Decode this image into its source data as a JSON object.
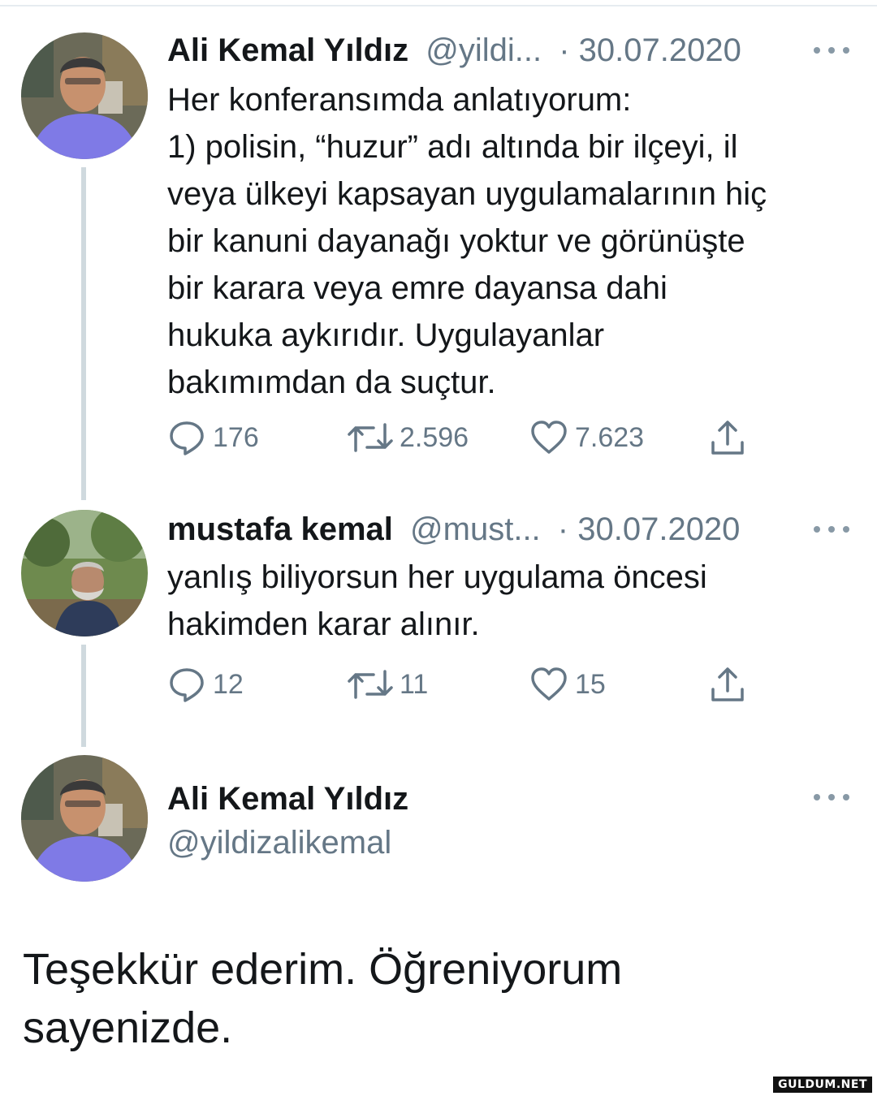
{
  "tweet1": {
    "name": "Ali Kemal Yıldız",
    "handle": "@yildi...",
    "date": "· 30.07.2020",
    "text": "Her konferansımda anlatıyorum:\n1) polisin, “huzur” adı altında bir ilçeyi, il\nveya ülkeyi kapsayan uygulamalarının hiç\nbir kanuni dayanağı yoktur ve görünüşte\nbir karara veya emre dayansa dahi\nhukuka aykırıdır. Uygulayanlar\nbakımımdan da suçtur.",
    "replies": "176",
    "retweets": "2.596",
    "likes": "7.623"
  },
  "tweet2": {
    "name": "mustafa kemal",
    "handle": "@must...",
    "date": "· 30.07.2020",
    "text": "yanlış biliyorsun her uygulama öncesi\nhakimden karar alınır.",
    "replies": "12",
    "retweets": "11",
    "likes": "15"
  },
  "tweet3": {
    "name": "Ali Kemal Yıldız",
    "handle": "@yildizalikemal",
    "text": "Teşekkür ederim. Öğreniyorum\nsayenizde."
  },
  "icons": {
    "reply": "reply-icon",
    "retweet": "retweet-icon",
    "like": "heart-icon",
    "share": "share-icon",
    "more": "more-icon"
  },
  "colors": {
    "text": "#14171a",
    "secondary": "#657786",
    "thread_line": "#cfd9de"
  },
  "watermark": "GULDUM.NET"
}
